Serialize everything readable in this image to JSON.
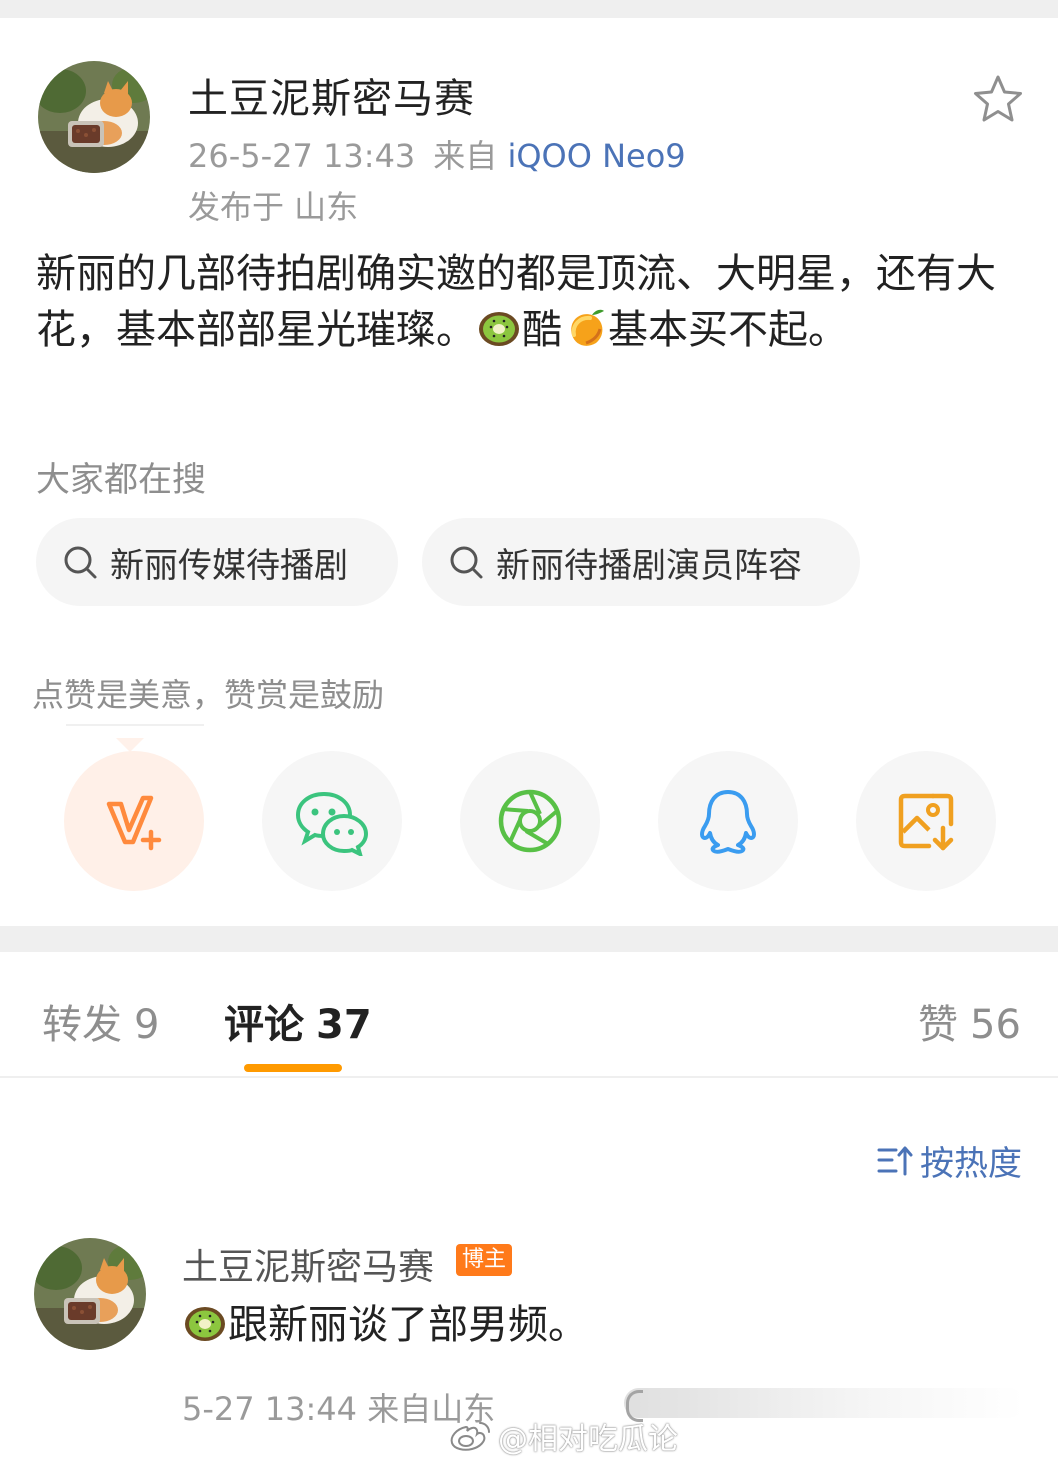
{
  "post": {
    "author_name": "土豆泥斯密马赛",
    "timestamp": "26-5-27 13:43",
    "source_prefix": "来自",
    "device": "iQOO Neo9",
    "location": "发布于 山东",
    "text_part1": "新丽的几部待拍剧确实邀的都是顶流、大明星，还有大花，基本部部星光璀璨。",
    "text_part2": "酷",
    "text_part3": "基本买不起。",
    "emoji_1": "kiwi-emoji",
    "emoji_2": "mango-emoji"
  },
  "search": {
    "label": "大家都在搜",
    "chips": [
      {
        "label": "新丽传媒待播剧"
      },
      {
        "label": "新丽待播剧演员阵容"
      }
    ]
  },
  "reward": {
    "hint": "点赞是美意，赞赏是鼓励"
  },
  "share": {
    "items": [
      {
        "icon": "v-plus-icon",
        "color": "#ff8a3d"
      },
      {
        "icon": "wechat-icon",
        "color": "#3bc47e"
      },
      {
        "icon": "moments-icon",
        "color": "#58c046"
      },
      {
        "icon": "qq-icon",
        "color": "#3a9cf0"
      },
      {
        "icon": "save-image-icon",
        "color": "#f0a020"
      }
    ]
  },
  "tabs": {
    "repost_label": "转发",
    "repost_count": "9",
    "comments_label": "评论",
    "comments_count": "37",
    "likes_label": "赞",
    "likes_count": "56",
    "active_color": "#ff9a00"
  },
  "sort": {
    "label": "按热度"
  },
  "comment": {
    "author_name": "土豆泥斯密马赛",
    "badge": "博主",
    "text": "跟新丽谈了部男频。",
    "emoji": "kiwi-emoji",
    "meta": "5-27 13:44  来自山东"
  },
  "watermark": {
    "text": "@相对吃瓜论"
  },
  "colors": {
    "link_blue": "#4b73b7",
    "badge_orange": "#ff7a1a",
    "muted_gray": "#9a9a9a"
  }
}
